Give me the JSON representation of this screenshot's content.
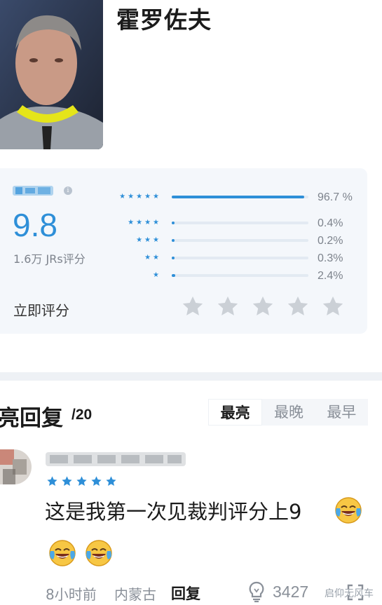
{
  "header": {
    "player_name": "霍罗佐夫"
  },
  "rating_card": {
    "score": "9.8",
    "rating_count": "1.6万 JRs评分",
    "distribution": [
      {
        "stars": "★★★★★",
        "percent_label": "96.7 %",
        "fraction": 0.967
      },
      {
        "stars": "★★★★",
        "percent_label": "0.4%",
        "fraction": 0.004
      },
      {
        "stars": "★★★",
        "percent_label": "0.2%",
        "fraction": 0.002
      },
      {
        "stars": "★★",
        "percent_label": "0.3%",
        "fraction": 0.003
      },
      {
        "stars": "★",
        "percent_label": "2.4%",
        "fraction": 0.024
      }
    ],
    "rate_now_label": "立即评分",
    "accent_color": "#2e8fd8"
  },
  "replies": {
    "title": "亮回复",
    "count": "/20",
    "sort_tabs": [
      {
        "label": "最亮",
        "active": true
      },
      {
        "label": "最晚",
        "active": false
      },
      {
        "label": "最早",
        "active": false
      }
    ]
  },
  "comment": {
    "user_rating_stars": 5,
    "text": "这是我第一次见裁判评分上9",
    "time": "8小时前",
    "location": "内蒙古",
    "reply_label": "回复",
    "light_count": "3427",
    "watermark": "启仰无风车"
  },
  "icons": {
    "info": "info-icon",
    "light": "lightbulb-icon",
    "expand": "expand-icon",
    "emoji": "tears-of-joy-emoji"
  }
}
